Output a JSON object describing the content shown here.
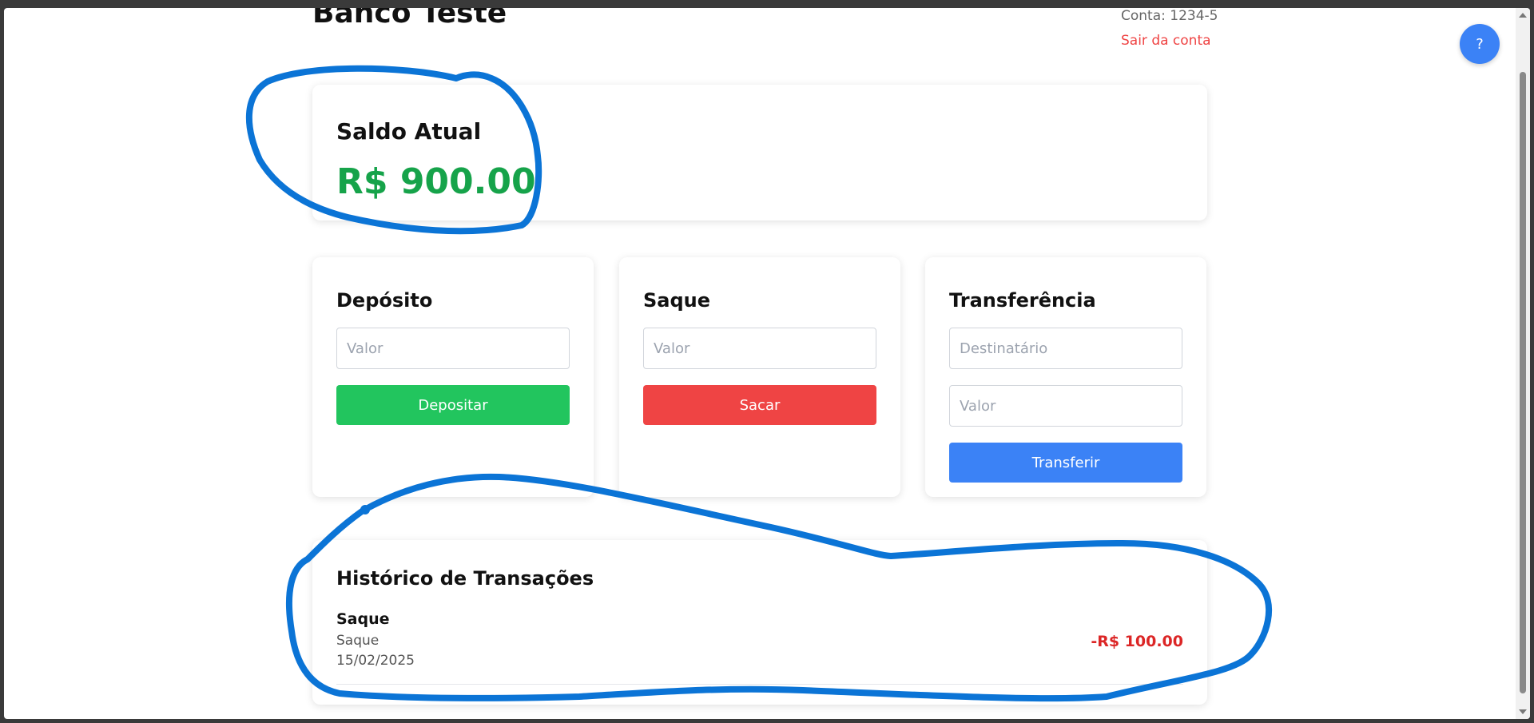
{
  "header": {
    "title": "Banco Teste",
    "account": "Conta: 1234-5",
    "logout_label": "Sair da conta"
  },
  "help": {
    "label": "?"
  },
  "balance": {
    "title": "Saldo Atual",
    "amount": "R$ 900.00"
  },
  "deposit": {
    "title": "Depósito",
    "amount_placeholder": "Valor",
    "button_label": "Depositar"
  },
  "withdraw": {
    "title": "Saque",
    "amount_placeholder": "Valor",
    "button_label": "Sacar"
  },
  "transfer": {
    "title": "Transferência",
    "recipient_placeholder": "Destinatário",
    "amount_placeholder": "Valor",
    "button_label": "Transferir"
  },
  "history": {
    "title": "Histórico de Transações",
    "transactions": [
      {
        "type": "Saque",
        "description": "Saque",
        "date": "15/02/2025",
        "amount": "-R$ 100.00"
      }
    ]
  },
  "colors": {
    "positive": "#16a34a",
    "negative": "#dc2626",
    "deposit_button": "#22c55e",
    "withdraw_button": "#ef4444",
    "transfer_button": "#3b82f6",
    "annotation_stroke": "#0b74d6"
  }
}
